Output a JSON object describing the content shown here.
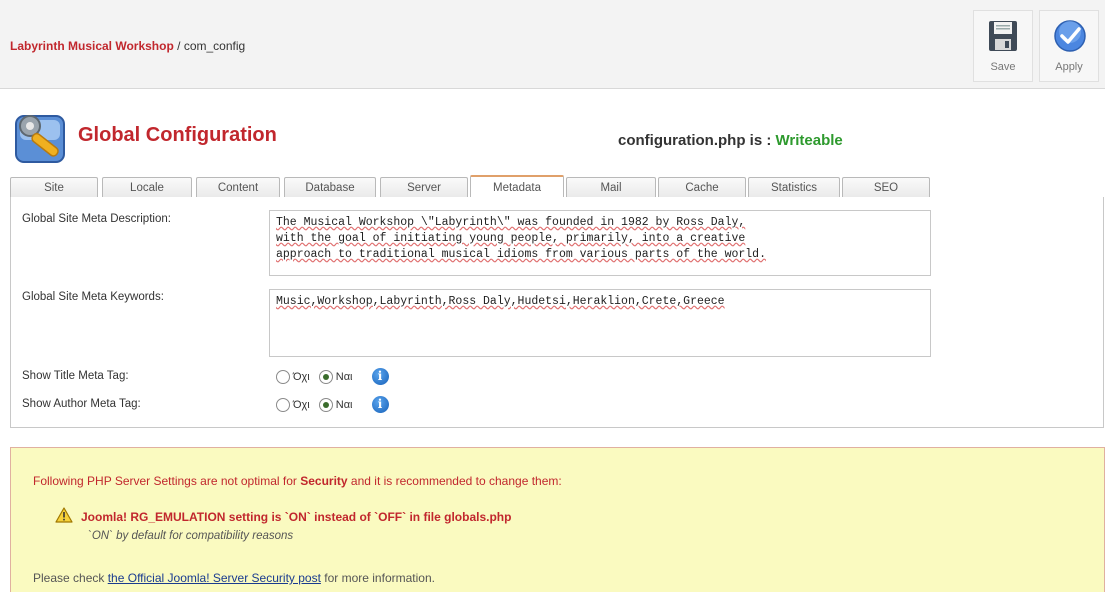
{
  "breadcrumb": {
    "site": "Labyrinth Musical Workshop",
    "path": " / com_config"
  },
  "toolbar": {
    "save_label": "Save",
    "apply_label": "Apply"
  },
  "page": {
    "title": "Global Configuration",
    "file_status_prefix": "configuration.php is : ",
    "file_status": "Writeable"
  },
  "tabs": [
    "Site",
    "Locale",
    "Content",
    "Database",
    "Server",
    "Metadata",
    "Mail",
    "Cache",
    "Statistics",
    "SEO"
  ],
  "active_tab": "Metadata",
  "metadata": {
    "desc_label": "Global Site Meta Description:",
    "desc_value": "The Musical Workshop \\\"Labyrinth\\\" was founded in 1982 by Ross Daly,\nwith the goal of initiating young people, primarily, into a creative\napproach to traditional musical idioms from various parts of the world.",
    "keywords_label": "Global Site Meta Keywords:",
    "keywords_value": "Music,Workshop,Labyrinth,Ross Daly,Hudetsi,Heraklion,Crete,Greece",
    "show_title_label": "Show Title Meta Tag:",
    "show_author_label": "Show Author Meta Tag:",
    "option_no": "Όχι",
    "option_yes": "Ναι",
    "info_glyph": "i"
  },
  "warning": {
    "intro_pre": "Following PHP Server Settings are not optimal for ",
    "intro_bold": "Security",
    "intro_post": " and it is recommended to change them:",
    "item": "Joomla! RG_EMULATION setting is `ON` instead of `OFF` in file globals.php",
    "item_note": "`ON` by default for compatibility reasons",
    "check_pre": "Please check ",
    "check_link": "the Official Joomla! Server Security post",
    "check_post": " for more information."
  },
  "colors": {
    "brand_red": "#c1272d",
    "ok_green": "#2e9a2e",
    "warning_bg": "#fafac0",
    "link_blue": "#1a3b8f"
  },
  "icons": {
    "save": "floppy-disk-icon",
    "apply": "checkmark-icon",
    "title": "config-gear-icon",
    "warning": "warning-triangle-icon",
    "info": "info-icon"
  }
}
